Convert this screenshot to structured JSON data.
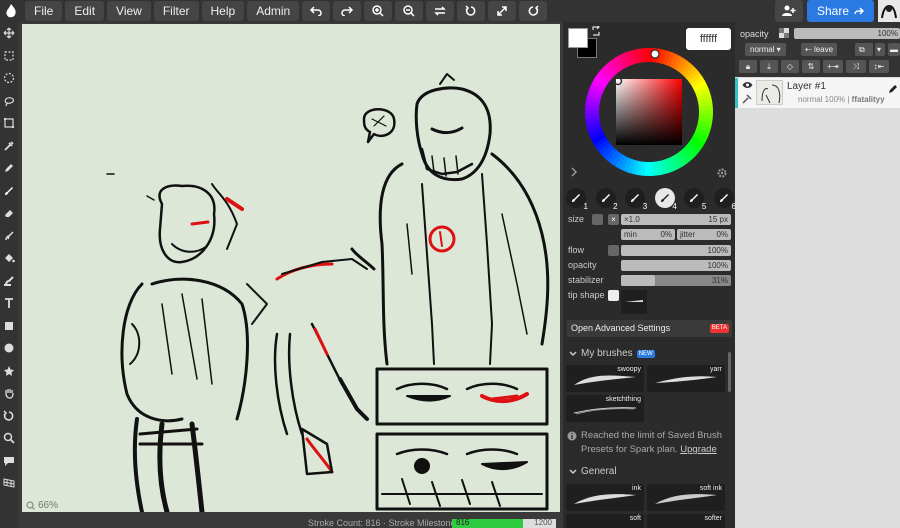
{
  "menu": {
    "items": [
      "File",
      "Edit",
      "View",
      "Filter",
      "Help",
      "Admin"
    ]
  },
  "toolbar_icons": [
    "undo-icon",
    "redo-icon",
    "zoom-in-icon",
    "zoom-out-icon",
    "flip-icon",
    "rotate-icon",
    "fullscreen-icon",
    "reset-icon"
  ],
  "share": {
    "label": "Share"
  },
  "left_tools": [
    "move-icon",
    "select-rect-icon",
    "select-ellipse-icon",
    "lasso-icon",
    "transform-icon",
    "eyedropper-icon",
    "pencil-icon",
    "brush-icon",
    "eraser-icon",
    "smudge-icon",
    "fill-icon",
    "blend-icon",
    "text-icon",
    "rect-shape-icon",
    "ellipse-shape-icon",
    "star-shape-icon",
    "hand-icon",
    "rotate-view-icon",
    "zoom-icon",
    "comment-icon",
    "grid-icon"
  ],
  "canvas": {
    "zoom_label": "66%"
  },
  "status": {
    "stroke_text": "Stroke Count: 816 · Stroke Milestone:",
    "milestone_value": "816",
    "milestone_max": "1200",
    "milestone_fraction": 0.68
  },
  "colors": {
    "foreground": "#ffffff",
    "background": "#000000",
    "hex_value": "ffffff",
    "accent": "#2a7ae2"
  },
  "brush": {
    "sizes": [
      "1",
      "2",
      "3",
      "4",
      "5",
      "6"
    ],
    "active_size_index": 3,
    "size_label": "size",
    "size_value": "15 px",
    "size_multiplier": "×1.0",
    "min_label": "min",
    "min_value": "0%",
    "jitter_label": "jitter",
    "jitter_value": "0%",
    "flow_label": "flow",
    "flow_value": "100%",
    "opacity_label": "opacity",
    "opacity_value": "100%",
    "stabilizer_label": "stabilizer",
    "stabilizer_value": "31%",
    "stabilizer_fraction": 0.31,
    "tip_shape_label": "tip shape"
  },
  "advanced": {
    "label": "Open Advanced Settings",
    "badge": "BETA"
  },
  "my_brushes": {
    "title": "My brushes",
    "badge": "NEW",
    "items": [
      "swoopy",
      "yarr",
      "sketchthing"
    ],
    "limit_text": "Reached the limit of Saved Brush Presets for Spark plan.",
    "upgrade_label": "Upgrade"
  },
  "general": {
    "title": "General",
    "items": [
      "ink",
      "soft ink",
      "soft",
      "softer"
    ]
  },
  "layers": {
    "opacity_label": "opacity",
    "opacity_value": "100%",
    "blend_mode": "normal",
    "leave_label": "leave",
    "layer_name": "Layer #1",
    "layer_meta_prefix": "normal 100% |",
    "layer_owner": "ffatalityy"
  }
}
